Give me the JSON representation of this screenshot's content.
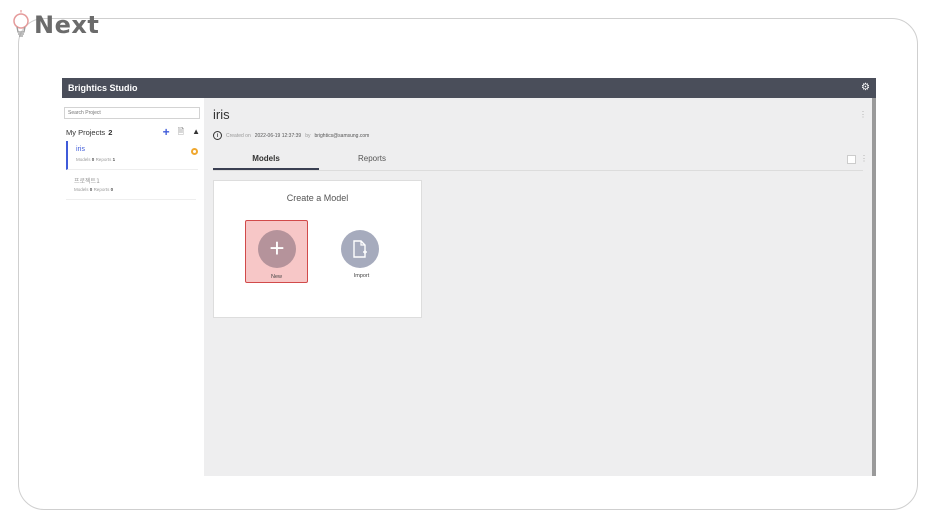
{
  "brand": {
    "name": "Next"
  },
  "app": {
    "title": "Brightics Studio"
  },
  "sidebar": {
    "search_placeholder": "Search Project",
    "projects_label": "My Projects",
    "projects_count": "2",
    "projects": [
      {
        "name": "iris",
        "models_label": "Models",
        "models": "0",
        "reports_label": "Reports",
        "reports": "1"
      },
      {
        "name": "프로젝트1",
        "models_label": "Models",
        "models": "0",
        "reports_label": "Reports",
        "reports": "0"
      }
    ]
  },
  "main": {
    "title": "iris",
    "created_label": "Created on",
    "created_date": "2022-06-19 12:37:39",
    "by_label": "by",
    "author": "brightics@samsung.com",
    "tabs": [
      {
        "label": "Models"
      },
      {
        "label": "Reports"
      }
    ],
    "card": {
      "title": "Create a Model",
      "new_label": "New",
      "import_label": "Import"
    }
  },
  "colors": {
    "titlebar": "#4a4e5a",
    "accent": "#3f5bd9",
    "new_highlight": "#f7c7c7",
    "badge": "#f0a830"
  },
  "icons": [
    "gear-icon",
    "plus-icon",
    "document-icon",
    "chevron-up-icon",
    "info-icon",
    "kebab-icon",
    "import-file-icon",
    "lightbulb-icon"
  ]
}
